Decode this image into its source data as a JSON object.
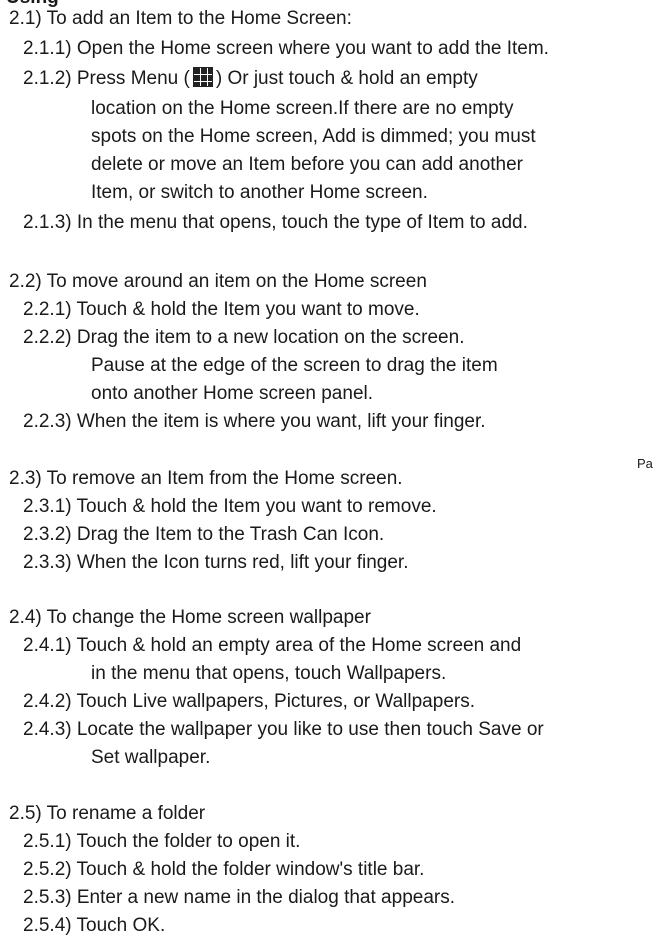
{
  "clipped_heading": "Using",
  "side_mark": "Pa",
  "sections": {
    "s21": {
      "heading": "2.1) To add an Item to the Home Screen:",
      "i1": "2.1.1) Open the Home screen where you want to add the Item.",
      "i2_a": "2.1.2) Press Menu (",
      "i2_b": ") Or just touch & hold an empty",
      "i2_c": "location on  the Home screen.If there are no empty",
      "i2_d": "spots on the Home screen, Add is dimmed; you must",
      "i2_e": "delete or move an Item before you can add another",
      "i2_f": "Item, or switch to another Home screen.",
      "i3": "2.1.3) In the menu that opens, touch the type of Item to add."
    },
    "s22": {
      "heading": "2.2) To move around an item on the Home screen",
      "i1": "2.2.1) Touch & hold the Item you want to move.",
      "i2_a": "2.2.2) Drag the item to a new location on the screen.",
      "i2_b": "Pause at the edge of the screen to drag the item",
      "i2_c": "onto another Home screen panel.",
      "i3": "2.2.3) When the item is where you want, lift your finger."
    },
    "s23": {
      "heading": "2.3) To remove an Item from the Home screen.",
      "i1": "2.3.1) Touch & hold the Item you want to remove.",
      "i2": "2.3.2) Drag the Item to the Trash Can Icon.",
      "i3": "2.3.3) When the Icon turns red, lift your finger."
    },
    "s24": {
      "heading": "2.4) To change the Home screen wallpaper",
      "i1_a": "2.4.1) Touch & hold an empty area of the Home screen and",
      "i1_b": "in the menu that opens, touch Wallpapers.",
      "i2": "2.4.2) Touch Live wallpapers, Pictures, or Wallpapers.",
      "i3_a": "2.4.3) Locate the wallpaper you like to use then touch Save or",
      "i3_b": "Set wallpaper."
    },
    "s25": {
      "heading": "2.5) To rename a folder",
      "i1": "2.5.1) Touch the folder to open it.",
      "i2": "2.5.2) Touch & hold the folder window's title bar.",
      "i3": "2.5.3) Enter a new name in the dialog that appears.",
      "i4": "2.5.4) Touch OK."
    }
  }
}
